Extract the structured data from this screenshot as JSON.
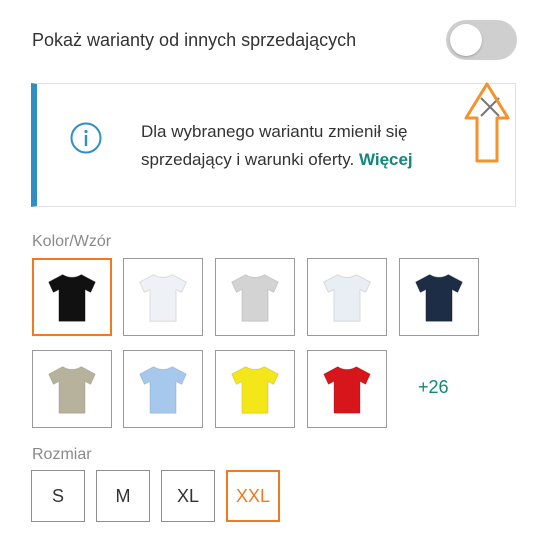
{
  "toggle": {
    "label": "Pokaż warianty od innych sprzedających",
    "on": false,
    "off_color": "#cfcfcf"
  },
  "notice": {
    "text": "Dla wybranego wariantu zmienił się sprzedający i warunki oferty.",
    "link": "Więcej",
    "icon": "info-icon",
    "close_icon": "close-icon",
    "accent_color": "#2f8fc4"
  },
  "annotation": {
    "icon": "arrow-up-icon",
    "color": "#f5922a"
  },
  "color_section": {
    "label": "Kolor/Wzór",
    "swatches": [
      {
        "name": "black",
        "color": "#111111",
        "selected": true
      },
      {
        "name": "white",
        "color": "#eef1f6",
        "selected": false
      },
      {
        "name": "light-grey",
        "color": "#d3d3d3",
        "selected": false
      },
      {
        "name": "white-2",
        "color": "#e9eef5",
        "selected": false
      },
      {
        "name": "navy",
        "color": "#1d2d45",
        "selected": false
      },
      {
        "name": "khaki",
        "color": "#b7b29c",
        "selected": false
      },
      {
        "name": "light-blue",
        "color": "#a5c8ec",
        "selected": false
      },
      {
        "name": "yellow",
        "color": "#f3e619",
        "selected": false
      },
      {
        "name": "red",
        "color": "#d6161b",
        "selected": false
      }
    ],
    "more": "+26"
  },
  "size_section": {
    "label": "Rozmiar",
    "sizes": [
      {
        "label": "S",
        "selected": false
      },
      {
        "label": "M",
        "selected": false
      },
      {
        "label": "XL",
        "selected": false
      },
      {
        "label": "XXL",
        "selected": true
      }
    ]
  },
  "accent_color": "#f07a1d",
  "link_color": "#12877a"
}
